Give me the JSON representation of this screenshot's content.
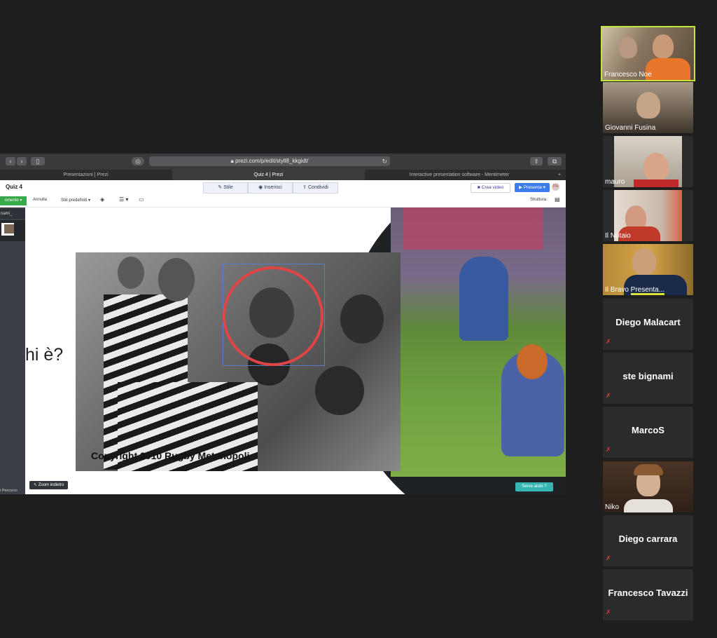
{
  "browser": {
    "url": "prezi.com/p/edit/styll8_kkgidt/",
    "tabs": [
      "Presentazioni | Prezi",
      "Quiz 4 | Prezi",
      "Interactive presentation software - Mentimeter"
    ],
    "new_tab": "+"
  },
  "prezi": {
    "title": "Quiz 4",
    "segments": [
      "Stile",
      "Inserisci",
      "Condividi"
    ],
    "crea_video": "Crea video",
    "presenta": "Presenta",
    "avatar_initials": "FN",
    "toolbar": {
      "green_btn": "omento",
      "annulla": "Annulla",
      "stili": "Stili predefiniti",
      "struttura": "Struttura"
    },
    "left_panel": {
      "top_label": "nami_",
      "bottom_label": "i Percorso"
    },
    "slide": {
      "question": "hi è?",
      "copyright": "Copyright  2010 Rugby Metanopoli",
      "zoom_back": "Zoom indietro",
      "help": "Serve aiuto"
    }
  },
  "participants": [
    {
      "name": "Francesco Noe",
      "video": true,
      "active": true
    },
    {
      "name": "Giovanni Fusina",
      "video": true
    },
    {
      "name": "mauro",
      "video": true
    },
    {
      "name": "Il Notaio",
      "video": true
    },
    {
      "name": "Il Bravo Presenta...",
      "video": true,
      "speaking": true
    },
    {
      "name": "Diego Malacart",
      "video": false,
      "muted": true
    },
    {
      "name": "ste bignami",
      "video": false,
      "muted": true
    },
    {
      "name": "MarcoS",
      "video": false,
      "muted": true
    },
    {
      "name": "Niko",
      "video": true
    },
    {
      "name": "Diego carrara",
      "video": false,
      "muted": true
    },
    {
      "name": "Francesco Tavazzi",
      "video": false,
      "muted": true
    }
  ],
  "colors": {
    "active_border": "#c6e53a",
    "mute_red": "#e03a3a",
    "prezi_blue": "#3b7bea",
    "help_teal": "#36b6b0"
  }
}
